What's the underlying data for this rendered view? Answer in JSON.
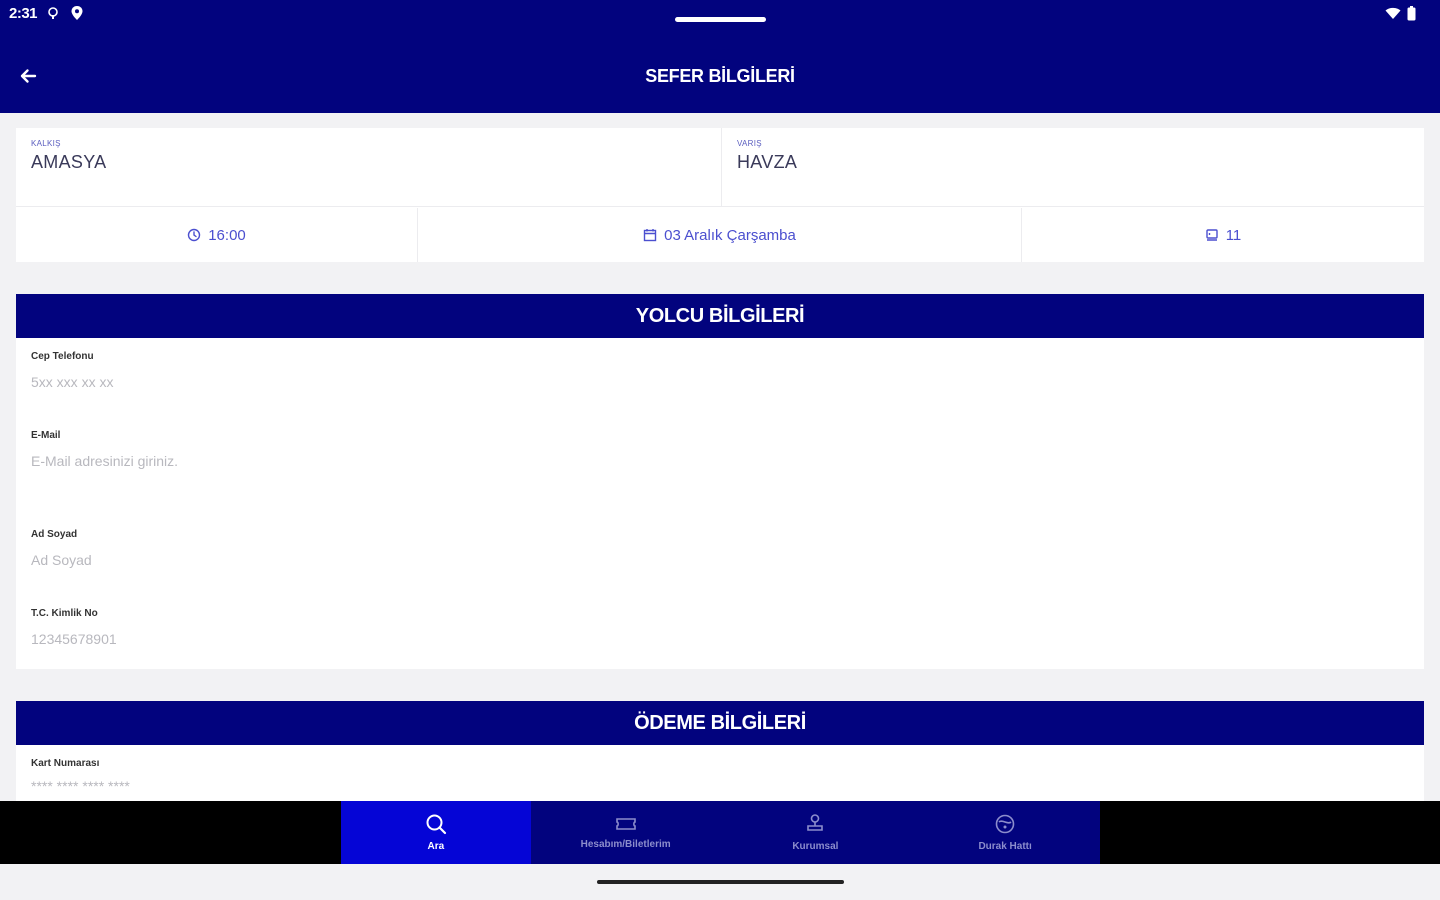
{
  "status_bar": {
    "time": "2:31"
  },
  "header": {
    "title": "SEFER BİLGİLERİ"
  },
  "route": {
    "from_label": "KALKIŞ",
    "from_value": "AMASYA",
    "to_label": "VARIŞ",
    "to_value": "HAVZA",
    "time": "16:00",
    "date": "03 Aralık Çarşamba",
    "seat": "11"
  },
  "passenger": {
    "title": "YOLCU BİLGİLERİ",
    "phone": {
      "label": "Cep Telefonu",
      "placeholder": "5xx xxx xx xx"
    },
    "email": {
      "label": "E-Mail",
      "placeholder": "E-Mail adresinizi giriniz."
    },
    "name": {
      "label": "Ad Soyad",
      "placeholder": "Ad Soyad"
    },
    "tc": {
      "label": "T.C. Kimlik No",
      "placeholder": "12345678901"
    }
  },
  "payment": {
    "title": "ÖDEME BİLGİLERİ",
    "card": {
      "label": "Kart Numarası",
      "placeholder": "**** **** **** ****"
    }
  },
  "bottom_nav": {
    "items": [
      {
        "label": "Ara",
        "icon": "search-icon",
        "active": true
      },
      {
        "label": "Hesabım/Biletlerim",
        "icon": "ticket-icon",
        "active": false
      },
      {
        "label": "Kurumsal",
        "icon": "stamp-icon",
        "active": false
      },
      {
        "label": "Durak Hattı",
        "icon": "route-icon",
        "active": false
      }
    ]
  },
  "colors": {
    "primary": "#02037e",
    "active_nav": "#0505d6",
    "accent_text": "#4b4fcf"
  }
}
